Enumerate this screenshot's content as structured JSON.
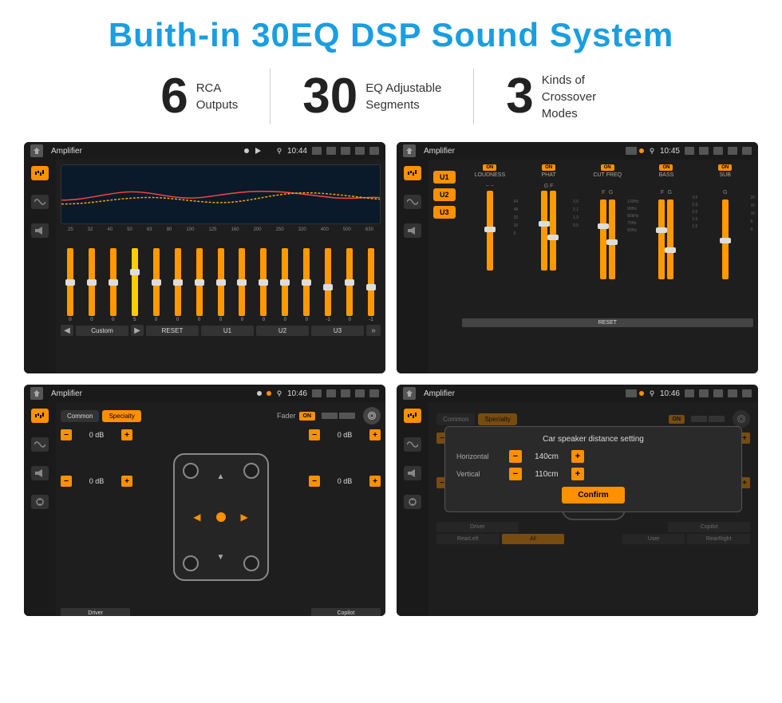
{
  "page": {
    "title": "Buith-in 30EQ DSP Sound System",
    "stats": [
      {
        "number": "6",
        "label": "RCA\nOutputs"
      },
      {
        "number": "30",
        "label": "EQ Adjustable\nSegments"
      },
      {
        "number": "3",
        "label": "Kinds of\nCrossover Modes"
      }
    ],
    "screenshots": [
      {
        "id": "eq-screen",
        "status": {
          "title": "Amplifier",
          "time": "10:44"
        },
        "type": "eq"
      },
      {
        "id": "crossover-screen",
        "status": {
          "title": "Amplifier",
          "time": "10:45"
        },
        "type": "crossover"
      },
      {
        "id": "fader-screen",
        "status": {
          "title": "Amplifier",
          "time": "10:46"
        },
        "type": "fader"
      },
      {
        "id": "distance-screen",
        "status": {
          "title": "Amplifier",
          "time": "10:46"
        },
        "type": "distance"
      }
    ],
    "eq": {
      "freqs": [
        "25",
        "32",
        "40",
        "50",
        "63",
        "80",
        "100",
        "125",
        "160",
        "200",
        "250",
        "320",
        "400",
        "500",
        "630"
      ],
      "values": [
        "0",
        "0",
        "0",
        "5",
        "0",
        "0",
        "0",
        "0",
        "0",
        "0",
        "0",
        "0",
        "-1",
        "0",
        "-1"
      ],
      "nav": [
        "Custom",
        "RESET",
        "U1",
        "U2",
        "U3"
      ]
    },
    "crossover": {
      "u_buttons": [
        "U1",
        "U2",
        "U3"
      ],
      "controls": [
        "LOUDNESS",
        "PHAT",
        "CUT FREQ",
        "BASS",
        "SUB"
      ],
      "reset_label": "RESET"
    },
    "fader": {
      "tabs": [
        "Common",
        "Specialty"
      ],
      "fader_label": "Fader",
      "on_label": "ON",
      "db_values": [
        "0 dB",
        "0 dB",
        "0 dB",
        "0 dB"
      ],
      "bottom_btns": [
        "Driver",
        "RearLeft",
        "All",
        "User",
        "RearRight",
        "Copilot"
      ]
    },
    "distance": {
      "dialog_title": "Car speaker distance setting",
      "horizontal_label": "Horizontal",
      "horizontal_value": "140cm",
      "vertical_label": "Vertical",
      "vertical_value": "110cm",
      "confirm_label": "Confirm"
    }
  }
}
